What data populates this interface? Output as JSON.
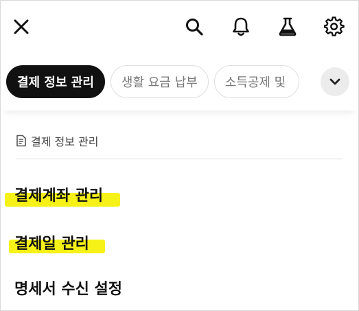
{
  "topbar": {
    "close_icon": "close-icon",
    "search_icon": "search-icon",
    "bell_icon": "bell-icon",
    "lab_icon": "flask-icon",
    "settings_icon": "gear-icon"
  },
  "tabs": [
    {
      "label": "결제 정보 관리",
      "active": true
    },
    {
      "label": "생활 요금 납부",
      "active": false
    },
    {
      "label": "소득공제 및",
      "active": false
    }
  ],
  "expand_icon": "chevron-down-icon",
  "section": {
    "icon": "document-icon",
    "title": "결제 정보 관리"
  },
  "menu": [
    {
      "label": "결제계좌 관리",
      "highlighted": true
    },
    {
      "label": "결제일 관리",
      "highlighted": true
    },
    {
      "label": "명세서 수신 설정",
      "highlighted": false
    }
  ],
  "colors": {
    "highlight": "#f6f218",
    "active_tab_bg": "#111111",
    "inactive_tab_text": "#777777"
  }
}
